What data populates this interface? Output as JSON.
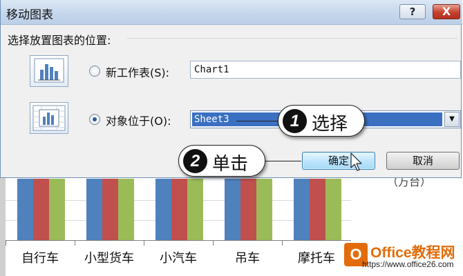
{
  "dialog": {
    "title": "移动图表",
    "help_label": "?",
    "close_label": "X",
    "group_label": "选择放置图表的位置:",
    "option_new_sheet": {
      "label": "新工作表(S):",
      "value": "Chart1",
      "checked": false
    },
    "option_object_in": {
      "label": "对象位于(O):",
      "value": "Sheet3",
      "checked": true
    },
    "ok_label": "确定",
    "cancel_label": "取消"
  },
  "callouts": [
    {
      "number": "1",
      "text": "选择"
    },
    {
      "number": "2",
      "text": "单击"
    }
  ],
  "chart": {
    "unit_label": "（万台）",
    "categories": [
      "自行车",
      "小型货车",
      "小汽车",
      "吊车",
      "摩托车"
    ]
  },
  "chart_data": {
    "type": "bar",
    "categories": [
      "自行车",
      "小型货车",
      "小汽车",
      "吊车",
      "摩托车"
    ],
    "series": [
      {
        "color": "#4f81bd"
      },
      {
        "color": "#c0504d"
      },
      {
        "color": "#9bbb59"
      }
    ],
    "ylabel": "（万台）"
  },
  "watermark": {
    "logo_letter": "O",
    "brand": "Office教程网",
    "url": "https://www.office26.com"
  },
  "colors": {
    "selection": "#3a6fc1",
    "series1": "#4f81bd",
    "series2": "#c0504d",
    "series3": "#9bbb59"
  }
}
